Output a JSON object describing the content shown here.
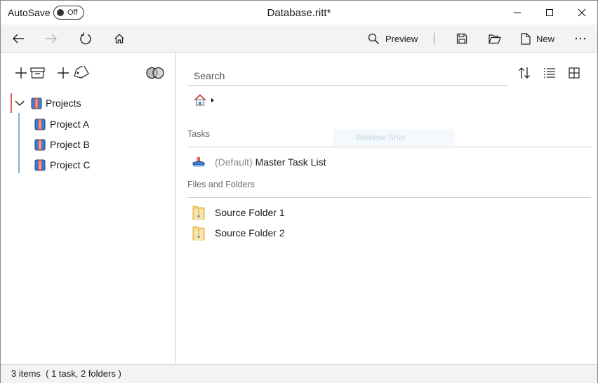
{
  "titlebar": {
    "autosave_label": "AutoSave",
    "autosave_state": "Off",
    "title": "Database.ritt*"
  },
  "toolbar": {
    "preview_label": "Preview",
    "new_label": "New",
    "icons": [
      "back-arrow-icon",
      "forward-arrow-icon",
      "refresh-icon",
      "home-icon",
      "search-icon",
      "save-icon",
      "open-folder-icon",
      "new-document-icon",
      "more-icon"
    ]
  },
  "sidebar": {
    "root": {
      "label": "Projects",
      "expanded": true
    },
    "children": [
      {
        "label": "Project A"
      },
      {
        "label": "Project B"
      },
      {
        "label": "Project C"
      }
    ]
  },
  "main": {
    "search_placeholder": "Search",
    "sections": {
      "tasks_heading": "Tasks",
      "files_heading": "Files and Folders"
    },
    "tasks": [
      {
        "tag": "(Default)",
        "label": "Master Task List"
      }
    ],
    "folders": [
      {
        "label": "Source Folder 1"
      },
      {
        "label": "Source Folder 2"
      }
    ],
    "overlay_text": "Window Snip"
  },
  "status": {
    "summary": "3 items  ( 1 task, 2 folders )"
  },
  "colors": {
    "accent_red": "#e05a5a",
    "tree_line": "#7fb3c9",
    "bar_bg": "#f3f3f3"
  }
}
